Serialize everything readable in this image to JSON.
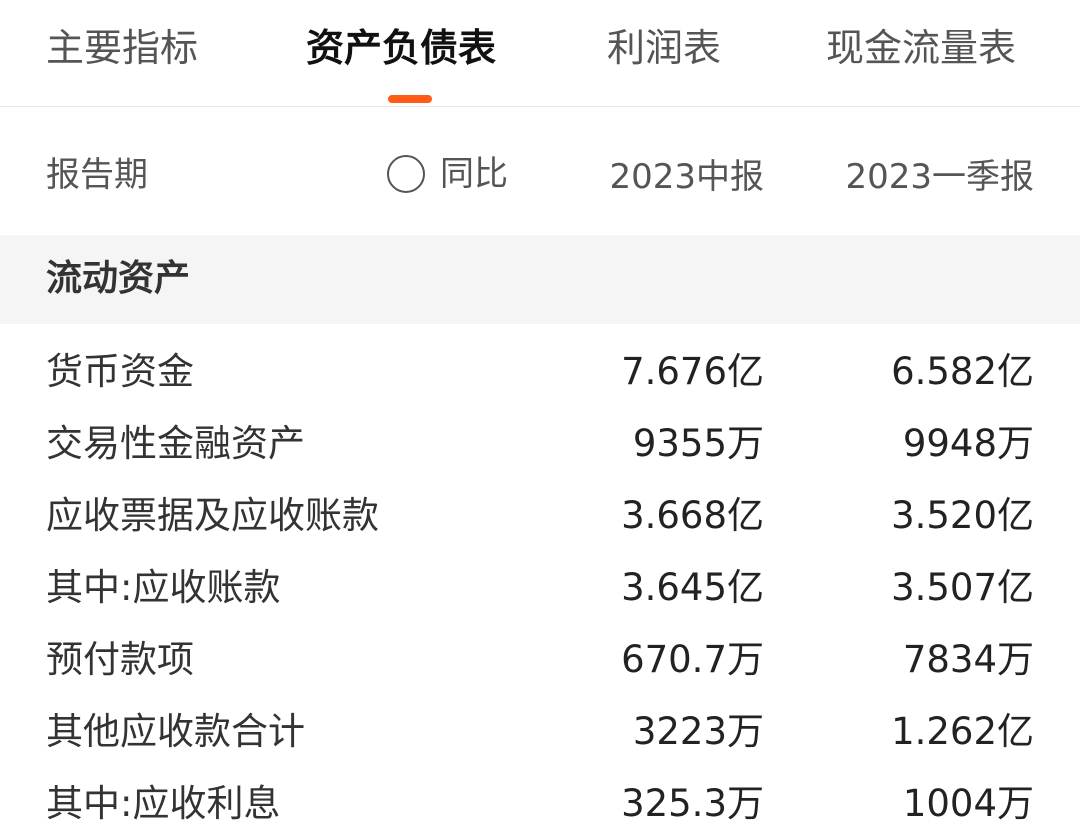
{
  "tabs": [
    {
      "label": "主要指标",
      "active": false
    },
    {
      "label": "资产负债表",
      "active": true
    },
    {
      "label": "利润表",
      "active": false
    },
    {
      "label": "现金流量表",
      "active": false
    }
  ],
  "accent_color": "#ff5a16",
  "period_header": {
    "label": "报告期",
    "yoy_label": "同比",
    "yoy_checked": false,
    "columns": [
      "2023中报",
      "2023一季报"
    ]
  },
  "section": {
    "title": "流动资产"
  },
  "rows": [
    {
      "label": "货币资金",
      "values": [
        "7.676亿",
        "6.582亿"
      ]
    },
    {
      "label": "交易性金融资产",
      "values": [
        "9355万",
        "9948万"
      ]
    },
    {
      "label": "应收票据及应收账款",
      "values": [
        "3.668亿",
        "3.520亿"
      ]
    },
    {
      "label": "其中:应收账款",
      "values": [
        "3.645亿",
        "3.507亿"
      ]
    },
    {
      "label": "预付款项",
      "values": [
        "670.7万",
        "7834万"
      ]
    },
    {
      "label": "其他应收款合计",
      "values": [
        "3223万",
        "1.262亿"
      ]
    },
    {
      "label": "其中:应收利息",
      "values": [
        "325.3万",
        "1004万"
      ]
    }
  ]
}
